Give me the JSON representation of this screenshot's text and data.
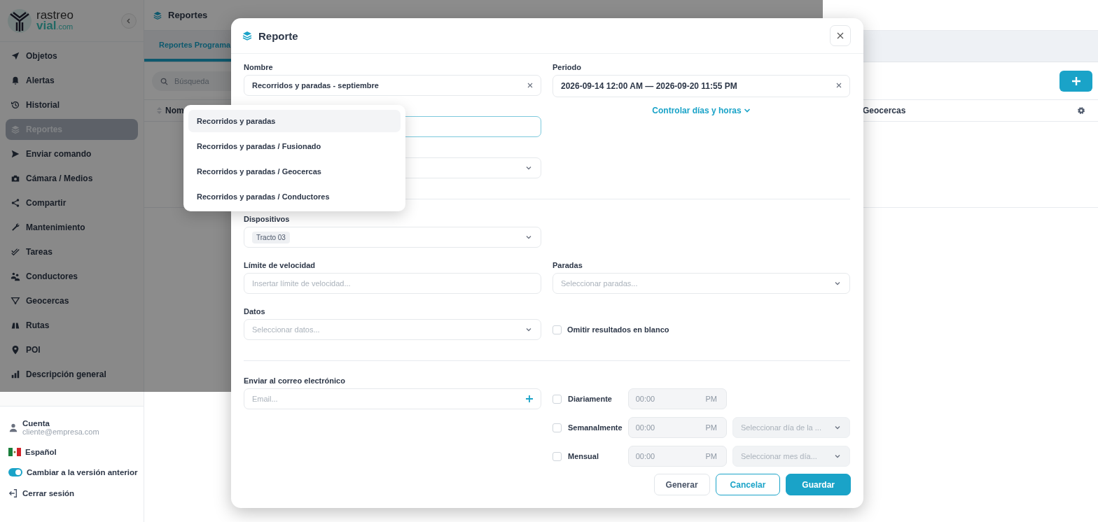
{
  "sidebar": {
    "logo": {
      "line1": "rastreo",
      "line2": "vial",
      "line2_suffix": ".com"
    },
    "items": [
      {
        "label": "Objetos",
        "selected": false
      },
      {
        "label": "Alertas",
        "selected": false
      },
      {
        "label": "Historial",
        "selected": false
      },
      {
        "label": "Reportes",
        "selected": true
      },
      {
        "label": "Enviar comando",
        "selected": false
      },
      {
        "label": "Cámara / Medios",
        "selected": false
      },
      {
        "label": "Compartir",
        "selected": false
      },
      {
        "label": "Mantenimiento",
        "selected": false
      },
      {
        "label": "Tareas",
        "selected": false
      },
      {
        "label": "Conductores",
        "selected": false
      },
      {
        "label": "Geocercas",
        "selected": false
      },
      {
        "label": "Rutas",
        "selected": false
      },
      {
        "label": "POI",
        "selected": false
      },
      {
        "label": "Descripción general",
        "selected": false
      }
    ],
    "footer": {
      "account": {
        "label": "Cuenta",
        "email": "cliente@empresa.com"
      },
      "language": "Español",
      "legacy_toggle": {
        "label": "Cambiar a la versión anterior",
        "on": true
      },
      "logout": "Cerrar sesión"
    }
  },
  "page": {
    "title": "Reportes",
    "tabs": [
      {
        "label": "Reportes Programa",
        "selected": true
      }
    ],
    "search": {
      "placeholder": "Búsqueda"
    },
    "table": {
      "columns": [
        "Nom",
        "Geocercas"
      ]
    }
  },
  "modal": {
    "title": "Reporte",
    "name": {
      "label": "Nombre",
      "value": "Recorridos y paradas - septiembre"
    },
    "period": {
      "label": "Periodo",
      "value": "2026-09-14 12:00 AM — 2026-09-20 11:55 PM"
    },
    "period_link": "Controlar días y horas",
    "devices": {
      "label": "Dispositivos",
      "chips": [
        "Tracto 03"
      ]
    },
    "speed_limit": {
      "label": "Límite de velocidad",
      "placeholder": "Insertar límite de velocidad..."
    },
    "stops": {
      "label": "Paradas",
      "placeholder": "Seleccionar paradas..."
    },
    "data": {
      "label": "Datos",
      "placeholder": "Seleccionar datos..."
    },
    "omit_empty": {
      "label": "Omitir resultados en blanco",
      "checked": false
    },
    "email": {
      "label": "Enviar al correo electrónico",
      "placeholder": "Email..."
    },
    "schedules": [
      {
        "label": "Diariamente",
        "checked": false,
        "time_placeholder": "00:00",
        "meridiem": "PM"
      },
      {
        "label": "Semanalmente",
        "checked": false,
        "time_placeholder": "00:00",
        "meridiem": "PM",
        "select_placeholder": "Seleccionar día de la ..."
      },
      {
        "label": "Mensual",
        "checked": false,
        "time_placeholder": "00:00",
        "meridiem": "PM",
        "select_placeholder": "Seleccionar mes día..."
      }
    ],
    "buttons": [
      {
        "label": "Generar",
        "kind": "secondary"
      },
      {
        "label": "Cancelar",
        "kind": "outline"
      },
      {
        "label": "Guardar",
        "kind": "primary"
      }
    ]
  },
  "dropdown": {
    "options": [
      {
        "label": "Recorridos y paradas",
        "selected": true
      },
      {
        "label": "Recorridos y paradas / Fusionado",
        "selected": false
      },
      {
        "label": "Recorridos y paradas / Geocercas",
        "selected": false
      },
      {
        "label": "Recorridos y paradas / Conductores",
        "selected": false
      }
    ]
  }
}
